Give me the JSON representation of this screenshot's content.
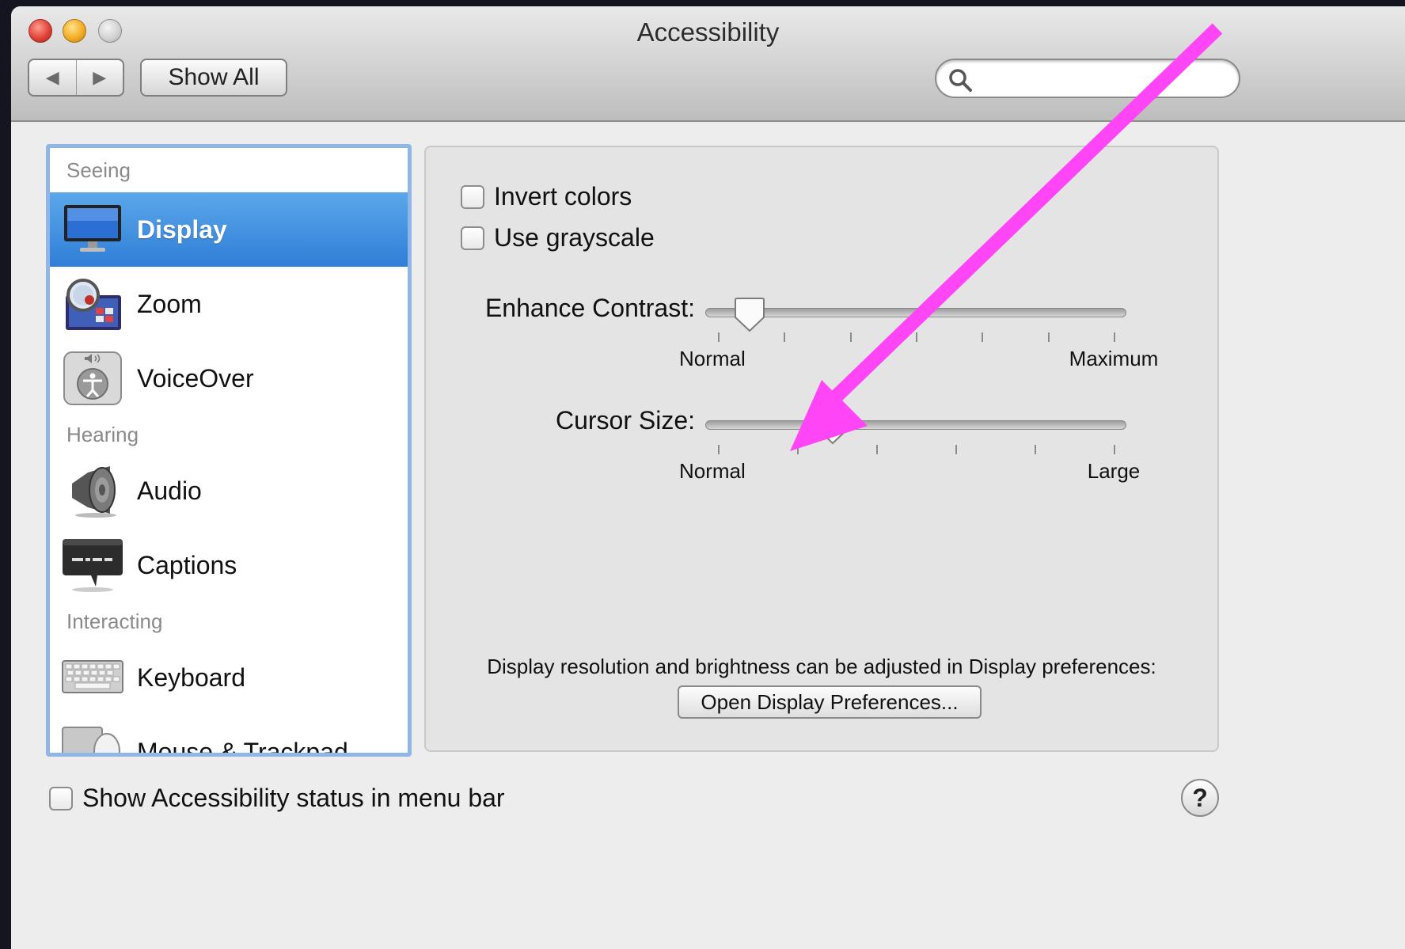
{
  "window": {
    "title": "Accessibility"
  },
  "toolbar": {
    "back_label": "◀",
    "forward_label": "▶",
    "show_all_label": "Show All",
    "search_placeholder": ""
  },
  "sidebar": {
    "groups": [
      {
        "header": "Seeing",
        "items": [
          {
            "label": "Display",
            "icon": "display-icon",
            "selected": true
          },
          {
            "label": "Zoom",
            "icon": "zoom-icon"
          },
          {
            "label": "VoiceOver",
            "icon": "voiceover-icon"
          }
        ]
      },
      {
        "header": "Hearing",
        "items": [
          {
            "label": "Audio",
            "icon": "speaker-icon"
          },
          {
            "label": "Captions",
            "icon": "captions-icon"
          }
        ]
      },
      {
        "header": "Interacting",
        "items": [
          {
            "label": "Keyboard",
            "icon": "keyboard-icon"
          },
          {
            "label": "Mouse & Trackpad",
            "icon": "mouse-icon"
          }
        ]
      }
    ]
  },
  "display_pane": {
    "invert_colors": {
      "label": "Invert colors",
      "checked": false
    },
    "use_grayscale": {
      "label": "Use grayscale",
      "checked": false
    },
    "enhance_contrast": {
      "label": "Enhance Contrast:",
      "min_label": "Normal",
      "max_label": "Maximum",
      "value_fraction": 0.08
    },
    "cursor_size": {
      "label": "Cursor Size:",
      "min_label": "Normal",
      "max_label": "Large",
      "value_fraction": 0.29
    },
    "info_text": "Display resolution and brightness can be adjusted in Display preferences:",
    "open_button_label": "Open Display Preferences..."
  },
  "footer": {
    "status_checkbox_label": "Show Accessibility status in menu bar",
    "status_checkbox_checked": false,
    "help_label": "?"
  },
  "annotation": {
    "arrow_color": "#ff45f5"
  },
  "colors": {
    "selection": "#3d8fe0",
    "sidebar_border": "#8fb6e6"
  }
}
